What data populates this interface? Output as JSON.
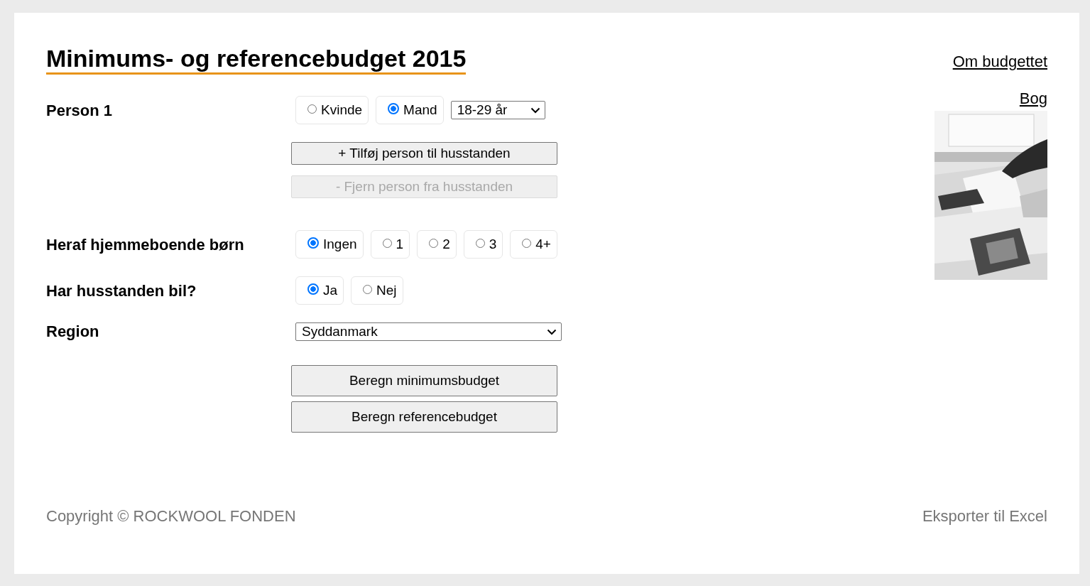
{
  "title": "Minimums- og referencebudget 2015",
  "links": [
    {
      "label": "Om budgettet"
    },
    {
      "label": "Bog"
    }
  ],
  "person": {
    "label": "Person 1",
    "options": [
      {
        "label": "Kvinde",
        "selected": false
      },
      {
        "label": "Mand",
        "selected": true
      }
    ],
    "age": {
      "value": "18-29 år"
    }
  },
  "add_button": {
    "label": "+ Tilføj person til husstanden",
    "disabled": false
  },
  "remove_button": {
    "label": "- Fjern person fra husstanden",
    "disabled": true
  },
  "children": {
    "label": "Heraf hjemmeboende børn",
    "options": [
      {
        "label": "Ingen",
        "selected": true
      },
      {
        "label": "1",
        "selected": false
      },
      {
        "label": "2",
        "selected": false
      },
      {
        "label": "3",
        "selected": false
      },
      {
        "label": "4+",
        "selected": false
      }
    ]
  },
  "car": {
    "label": "Har husstanden bil?",
    "options": [
      {
        "label": "Ja",
        "selected": true
      },
      {
        "label": "Nej",
        "selected": false
      }
    ]
  },
  "region": {
    "label": "Region",
    "value": "Syddanmark"
  },
  "actions": [
    {
      "label": "Beregn minimumsbudget",
      "disabled": false
    },
    {
      "label": "Beregn referencebudget",
      "disabled": false
    }
  ],
  "footer": {
    "copyright": "Copyright © ROCKWOOL FONDEN",
    "export_link": "Eksporter til Excel"
  }
}
